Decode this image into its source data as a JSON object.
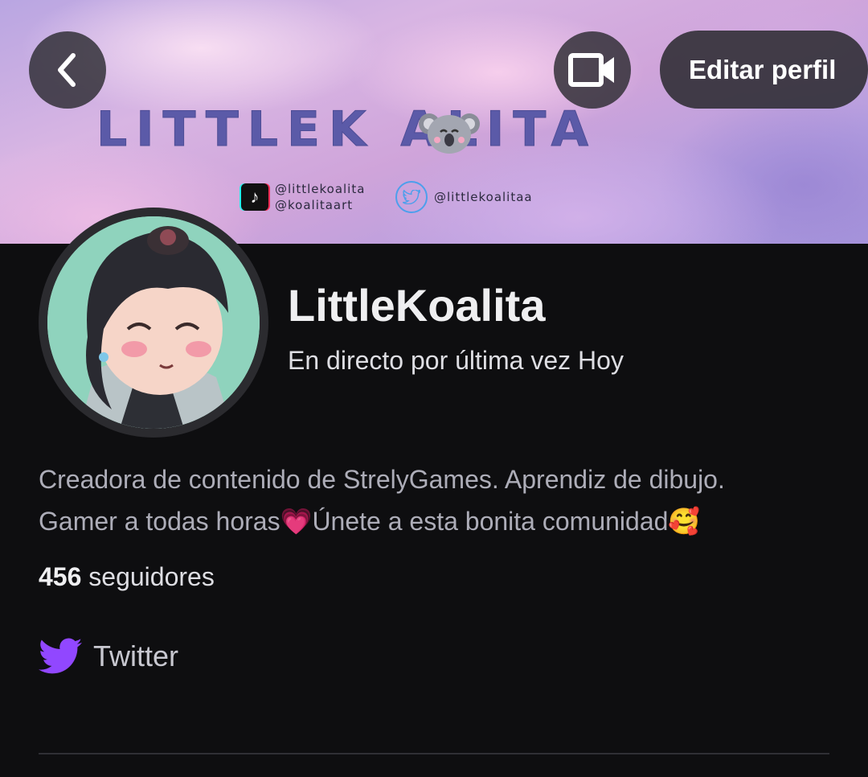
{
  "banner": {
    "title": "LITTLEK  ALITA",
    "tiktok_handles": [
      "@littlekoalita",
      "@koalitaart"
    ],
    "twitter_handle": "@littlekoalitaa"
  },
  "header": {
    "back_icon": "chevron-left-icon",
    "camera_icon": "video-camera-icon",
    "edit_profile_label": "Editar perfil"
  },
  "profile": {
    "username": "LittleKoalita",
    "last_live": "En directo por última vez Hoy",
    "bio_line1": "Creadora de contenido de StrelyGames. Aprendiz de dibujo.",
    "bio_line2": "Gamer a todas horas💗Únete a esta bonita comunidad🥰",
    "followers_count": "456",
    "followers_label": "seguidores"
  },
  "links": [
    {
      "label": "Twitter",
      "icon": "twitter-bird-icon",
      "color": "#9147ff"
    }
  ],
  "colors": {
    "background": "#0e0e10",
    "accent": "#9147ff",
    "banner_text": "#5b5aa8"
  }
}
